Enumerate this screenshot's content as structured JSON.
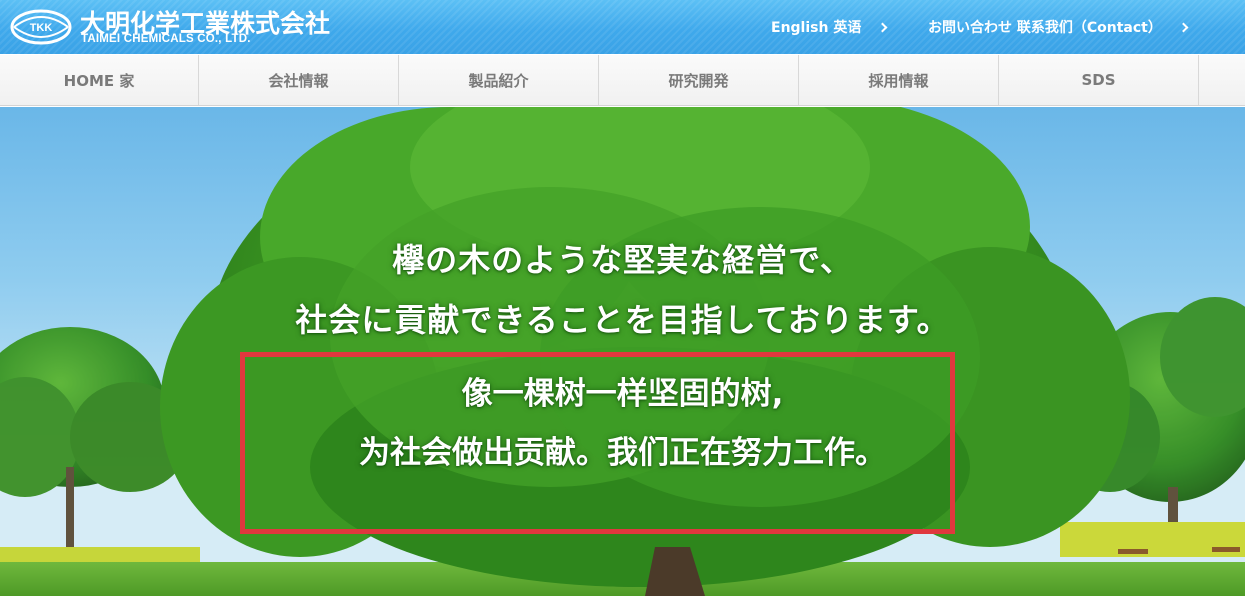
{
  "header": {
    "logo_mark_text": "TKK",
    "company_name_jp": "大明化学工業株式会社",
    "company_name_en": "TAIMEI CHEMICALS CO., LTD.",
    "links": [
      {
        "label": "English 英语"
      },
      {
        "label": "お問い合わせ 联系我们（Contact）"
      }
    ]
  },
  "nav": {
    "items": [
      {
        "label": "HOME 家"
      },
      {
        "label": "会社情報"
      },
      {
        "label": "製品紹介"
      },
      {
        "label": "研究開発"
      },
      {
        "label": "採用情報"
      },
      {
        "label": "SDS"
      }
    ]
  },
  "hero": {
    "headline_jp_1": "欅の木のような堅実な経営で、",
    "headline_jp_2": "社会に貢献できることを目指しております。",
    "headline_cn_1": "像一棵树一样坚固的树,",
    "headline_cn_2": "为社会做出贡献。我们正在努力工作。",
    "highlight_color": "#e0383e"
  },
  "colors": {
    "header_blue": "#3fa9ec",
    "nav_text": "#7a7a7a",
    "foliage": "#3e9a22",
    "sky": "#8fccef"
  }
}
